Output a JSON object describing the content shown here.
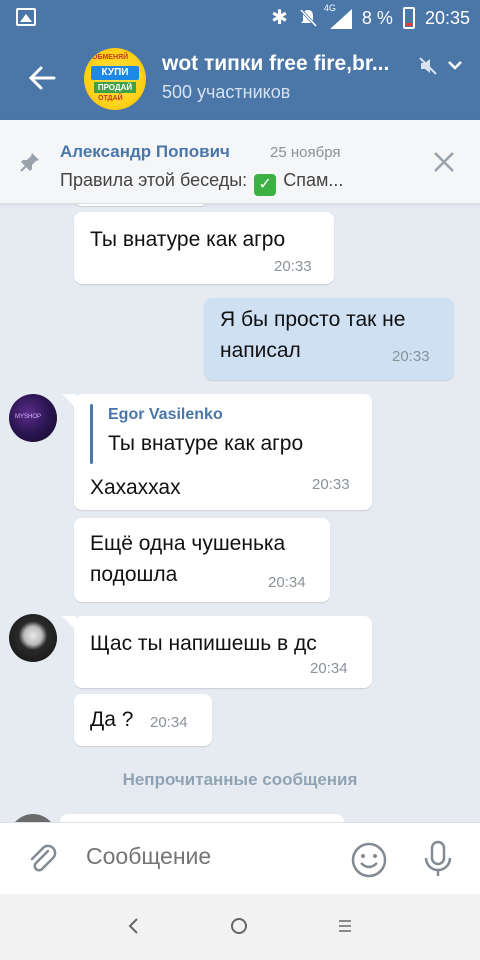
{
  "status_bar": {
    "network": "4G",
    "battery_percent": "8 %",
    "time": "20:35",
    "colors": {
      "bar": "#4a76a8",
      "battery_low": "#e53935"
    }
  },
  "header": {
    "title": "wot типки free fire,br...",
    "subtitle": "500 участников",
    "avatar_text": [
      "ОБМЕНЯЙ",
      "КУПИ",
      "ПРОДАЙ",
      "ОТДАЙ"
    ]
  },
  "pinned": {
    "author": "Александр Попович",
    "date": "25 ноября",
    "text_prefix": "Правила этой беседы:",
    "check_emoji": "✓",
    "text_suffix": "Спам..."
  },
  "messages": [
    {
      "text": "Ты внатуре как агро",
      "time": "20:33"
    },
    {
      "text": "Я бы просто так не написал",
      "time": "20:33",
      "outgoing": true
    },
    {
      "reply_author": "Egor Vasilenko",
      "reply_text": "Ты внатуре как агро",
      "text": "Хахаххах",
      "time": "20:33"
    },
    {
      "text": "Ещё одна чушенька подошла",
      "time": "20:34"
    },
    {
      "text": "Щас ты напишешь в дс",
      "time": "20:34"
    },
    {
      "text": "Да ?",
      "time": "20:34"
    }
  ],
  "unread_divider": "Непрочитанные сообщения",
  "composer": {
    "placeholder": "Сообщение"
  },
  "icons": [
    "back-arrow-icon",
    "mute-icon",
    "chevron-down-icon",
    "pin-icon",
    "close-icon",
    "attach-icon",
    "smile-icon",
    "mic-icon",
    "nav-back-icon",
    "nav-home-icon",
    "nav-menu-icon"
  ]
}
